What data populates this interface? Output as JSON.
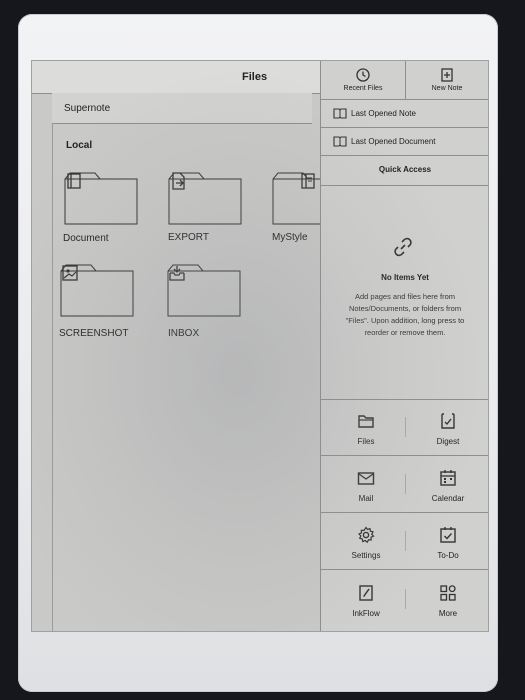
{
  "header": {
    "title": "Files"
  },
  "breadcrumb": {
    "path": "Supernote"
  },
  "section": {
    "label": "Local"
  },
  "folders": [
    {
      "label": "Document",
      "icon": "book-icon"
    },
    {
      "label": "EXPORT",
      "icon": "export-file-icon"
    },
    {
      "label": "MyStyle",
      "icon": "template-icon"
    },
    {
      "label": "SCREENSHOT",
      "icon": "image-icon"
    },
    {
      "label": "INBOX",
      "icon": "inbox-tray-icon"
    }
  ],
  "panel": {
    "recent_files": "Recent Files",
    "new_note": "New Note",
    "last_opened_note": "Last Opened Note",
    "last_opened_document": "Last Opened Document",
    "quick_access": "Quick Access",
    "empty_title": "No Items Yet",
    "empty_text": "Add pages and files here from Notes/Documents, or folders from \"Files\". Upon addition, long press to reorder or remove them."
  },
  "apps": [
    {
      "label": "Files",
      "icon": "folder-icon"
    },
    {
      "label": "Digest",
      "icon": "digest-icon"
    },
    {
      "label": "Mail",
      "icon": "mail-icon"
    },
    {
      "label": "Calendar",
      "icon": "calendar-icon"
    },
    {
      "label": "Settings",
      "icon": "gear-icon"
    },
    {
      "label": "To-Do",
      "icon": "todo-icon"
    },
    {
      "label": "InkFlow",
      "icon": "inkflow-icon"
    },
    {
      "label": "More",
      "icon": "more-apps-icon"
    }
  ]
}
